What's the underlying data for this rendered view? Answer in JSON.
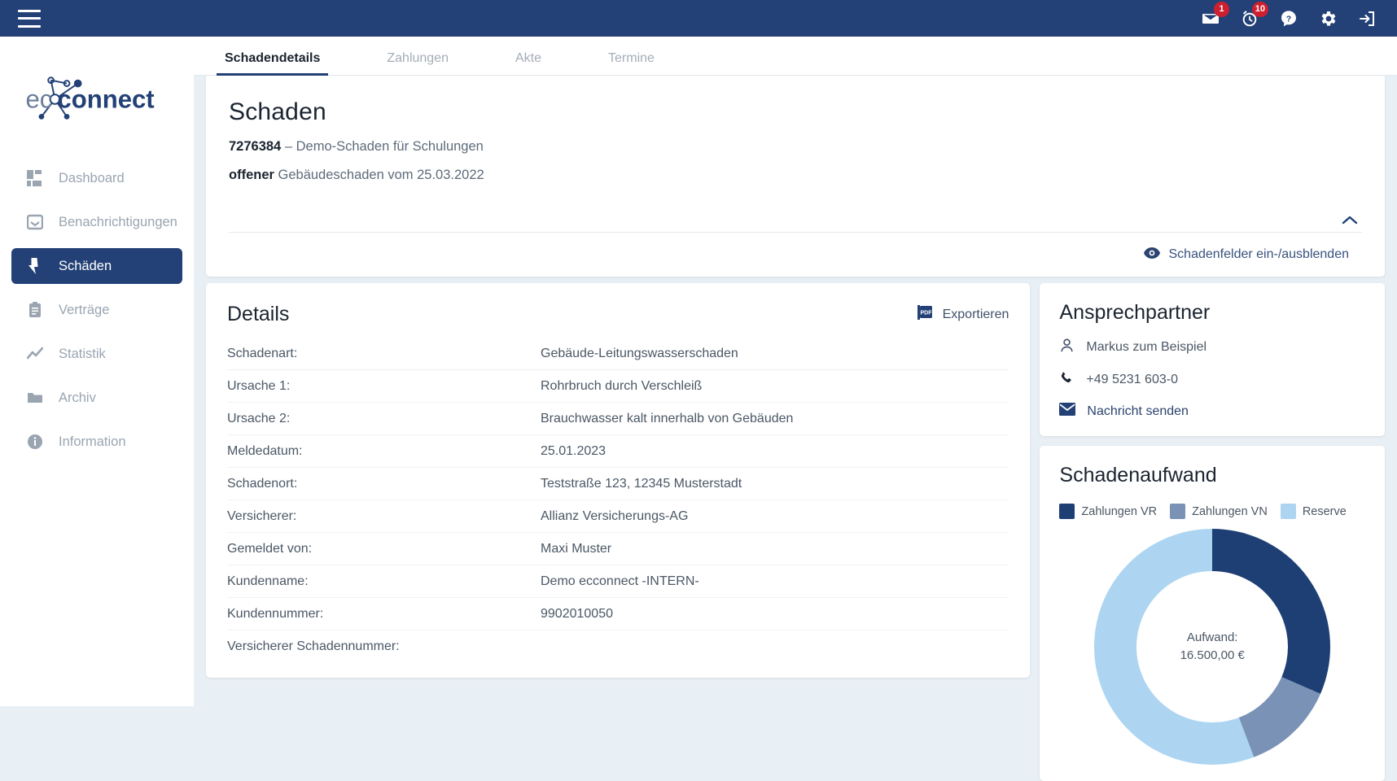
{
  "topbar": {
    "menu_icon": "hamburger-icon",
    "icons": [
      {
        "name": "mail-icon",
        "badge": "1"
      },
      {
        "name": "alarm-clock-icon",
        "badge": "10"
      },
      {
        "name": "help-icon",
        "badge": ""
      },
      {
        "name": "gear-icon",
        "badge": ""
      },
      {
        "name": "logout-icon",
        "badge": ""
      }
    ]
  },
  "sidebar": {
    "logo_text": "ecconnect",
    "items": [
      {
        "label": "Dashboard",
        "icon": "dashboard-icon",
        "active": false
      },
      {
        "label": "Benachrichtigungen",
        "icon": "inbox-icon",
        "active": false
      },
      {
        "label": "Schäden",
        "icon": "bolt-icon",
        "active": true
      },
      {
        "label": "Verträge",
        "icon": "clipboard-icon",
        "active": false
      },
      {
        "label": "Statistik",
        "icon": "chart-line-icon",
        "active": false
      },
      {
        "label": "Archiv",
        "icon": "folder-icon",
        "active": false
      },
      {
        "label": "Information",
        "icon": "info-icon",
        "active": false
      }
    ]
  },
  "tabs": [
    {
      "label": "Schadendetails",
      "active": true
    },
    {
      "label": "Zahlungen",
      "active": false
    },
    {
      "label": "Akte",
      "active": false
    },
    {
      "label": "Termine",
      "active": false
    }
  ],
  "header": {
    "title": "Schaden",
    "claim_number": "7276384",
    "claim_separator": " – ",
    "claim_description": "Demo-Schaden für Schulungen",
    "status": "offener",
    "status_rest": " Gebäudeschaden vom 25.03.2022",
    "collapse_icon": "chevron-up-icon",
    "toggle_fields_label": "Schadenfelder ein-/ausblenden",
    "toggle_fields_icon": "eye-icon"
  },
  "details": {
    "title": "Details",
    "export_label": "Exportieren",
    "export_icon": "pdf-icon",
    "rows": [
      {
        "label": "Schadenart:",
        "value": "Gebäude-Leitungswasserschaden"
      },
      {
        "label": "Ursache 1:",
        "value": "Rohrbruch durch Verschleiß"
      },
      {
        "label": "Ursache 2:",
        "value": "Brauchwasser kalt innerhalb von Gebäuden"
      },
      {
        "label": "Meldedatum:",
        "value": "25.01.2023"
      },
      {
        "label": "Schadenort:",
        "value": "Teststraße 123, 12345 Musterstadt"
      },
      {
        "label": "Versicherer:",
        "value": "Allianz Versicherungs-AG"
      },
      {
        "label": "Gemeldet von:",
        "value": "Maxi Muster"
      },
      {
        "label": "Kundenname:",
        "value": "Demo ecconnect -INTERN-"
      },
      {
        "label": "Kundennummer:",
        "value": "9902010050"
      },
      {
        "label": "Versicherer Schadennummer:",
        "value": ""
      }
    ]
  },
  "contact": {
    "title": "Ansprechpartner",
    "person": "Markus zum Beispiel",
    "person_icon": "user-icon",
    "phone": "+49 5231 603-0",
    "phone_icon": "phone-icon",
    "message_label": "Nachricht senden",
    "message_icon": "envelope-icon"
  },
  "expense": {
    "title": "Schadenaufwand"
  },
  "chart_data": {
    "type": "pie",
    "title": "Schadenaufwand",
    "center_label": "Aufwand:",
    "center_value": "16.500,00 €",
    "legend_position": "top",
    "categories": [
      "Zahlungen VR",
      "Zahlungen VN",
      "Reserve"
    ],
    "values": [
      5200,
      2100,
      9200
    ],
    "percentages": [
      31.5,
      12.7,
      55.8
    ],
    "colors": [
      "#1e3f74",
      "#7a92b5",
      "#add5f2"
    ],
    "total": 16500,
    "unit": "€"
  },
  "colors": {
    "brand_dark": "#234176",
    "badge_red": "#cf1f2e",
    "page_bg": "#e9f0f5",
    "muted_text": "#9aa5b1"
  }
}
